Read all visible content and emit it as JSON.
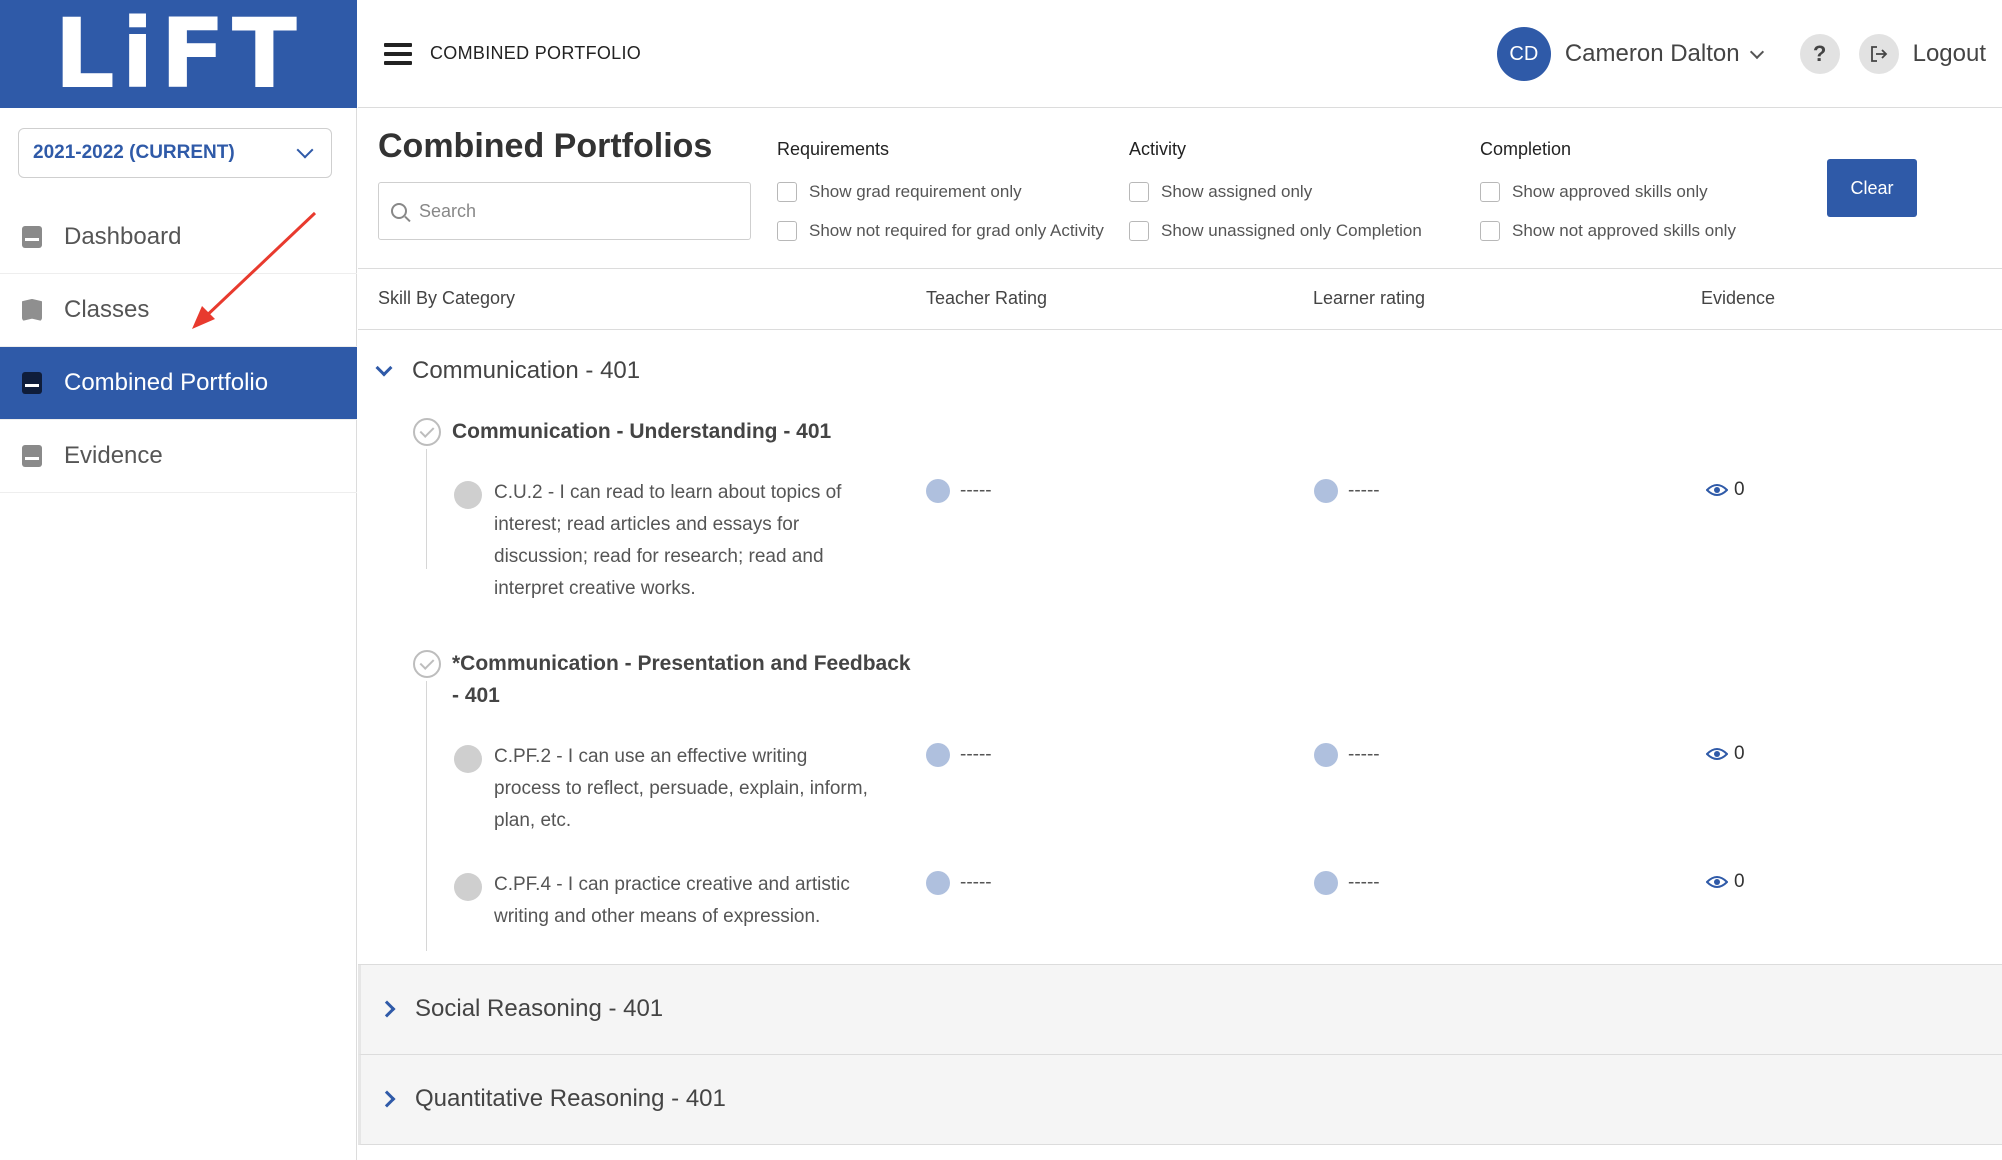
{
  "app": {
    "logo": "LiFT",
    "brand_color": "#2f5aa8"
  },
  "sidebar": {
    "year": "2021-2022 (CURRENT)",
    "items": [
      {
        "label": "Dashboard",
        "icon": "file-icon"
      },
      {
        "label": "Classes",
        "icon": "book-icon"
      },
      {
        "label": "Combined Portfolio",
        "icon": "file-icon",
        "active": true
      },
      {
        "label": "Evidence",
        "icon": "file-icon"
      }
    ]
  },
  "header": {
    "page_label": "COMBINED PORTFOLIO",
    "user_initials": "CD",
    "user_name": "Cameron Dalton",
    "help": "?",
    "logout": "Logout"
  },
  "filters": {
    "title": "Combined Portfolios",
    "search_placeholder": "Search",
    "requirements": {
      "title": "Requirements",
      "options": [
        "Show grad requirement only",
        "Show not required for grad only Activity"
      ]
    },
    "activity": {
      "title": "Activity",
      "options": [
        "Show assigned only",
        "Show unassigned only Completion"
      ]
    },
    "completion": {
      "title": "Completion",
      "options": [
        "Show approved skills only",
        "Show not approved skills only"
      ]
    },
    "clear": "Clear"
  },
  "table": {
    "columns": [
      "Skill By Category",
      "Teacher Rating",
      "Learner rating",
      "Evidence"
    ]
  },
  "categories": [
    {
      "title": "Communication - 401",
      "expanded": true,
      "subcategories": [
        {
          "title": "Communication - Understanding - 401",
          "skills": [
            {
              "lines": [
                "C.U.2 - I can read to learn about topics of",
                "interest; read articles and essays for",
                "discussion; read for research; read and",
                "interpret creative works."
              ],
              "teacher": "-----",
              "learner": "-----",
              "evidence": "0"
            }
          ]
        },
        {
          "title_lines": [
            "*Communication - Presentation and Feedback",
            "- 401"
          ],
          "skills": [
            {
              "lines": [
                "C.PF.2 - I can use an effective writing",
                "process to reflect, persuade, explain, inform,",
                "plan, etc."
              ],
              "teacher": "-----",
              "learner": "-----",
              "evidence": "0"
            },
            {
              "lines": [
                "C.PF.4 - I can practice creative and artistic",
                "writing and other means of expression."
              ],
              "teacher": "-----",
              "learner": "-----",
              "evidence": "0"
            }
          ]
        }
      ]
    },
    {
      "title": "Social Reasoning - 401",
      "expanded": false
    },
    {
      "title": "Quantitative Reasoning - 401",
      "expanded": false
    }
  ]
}
